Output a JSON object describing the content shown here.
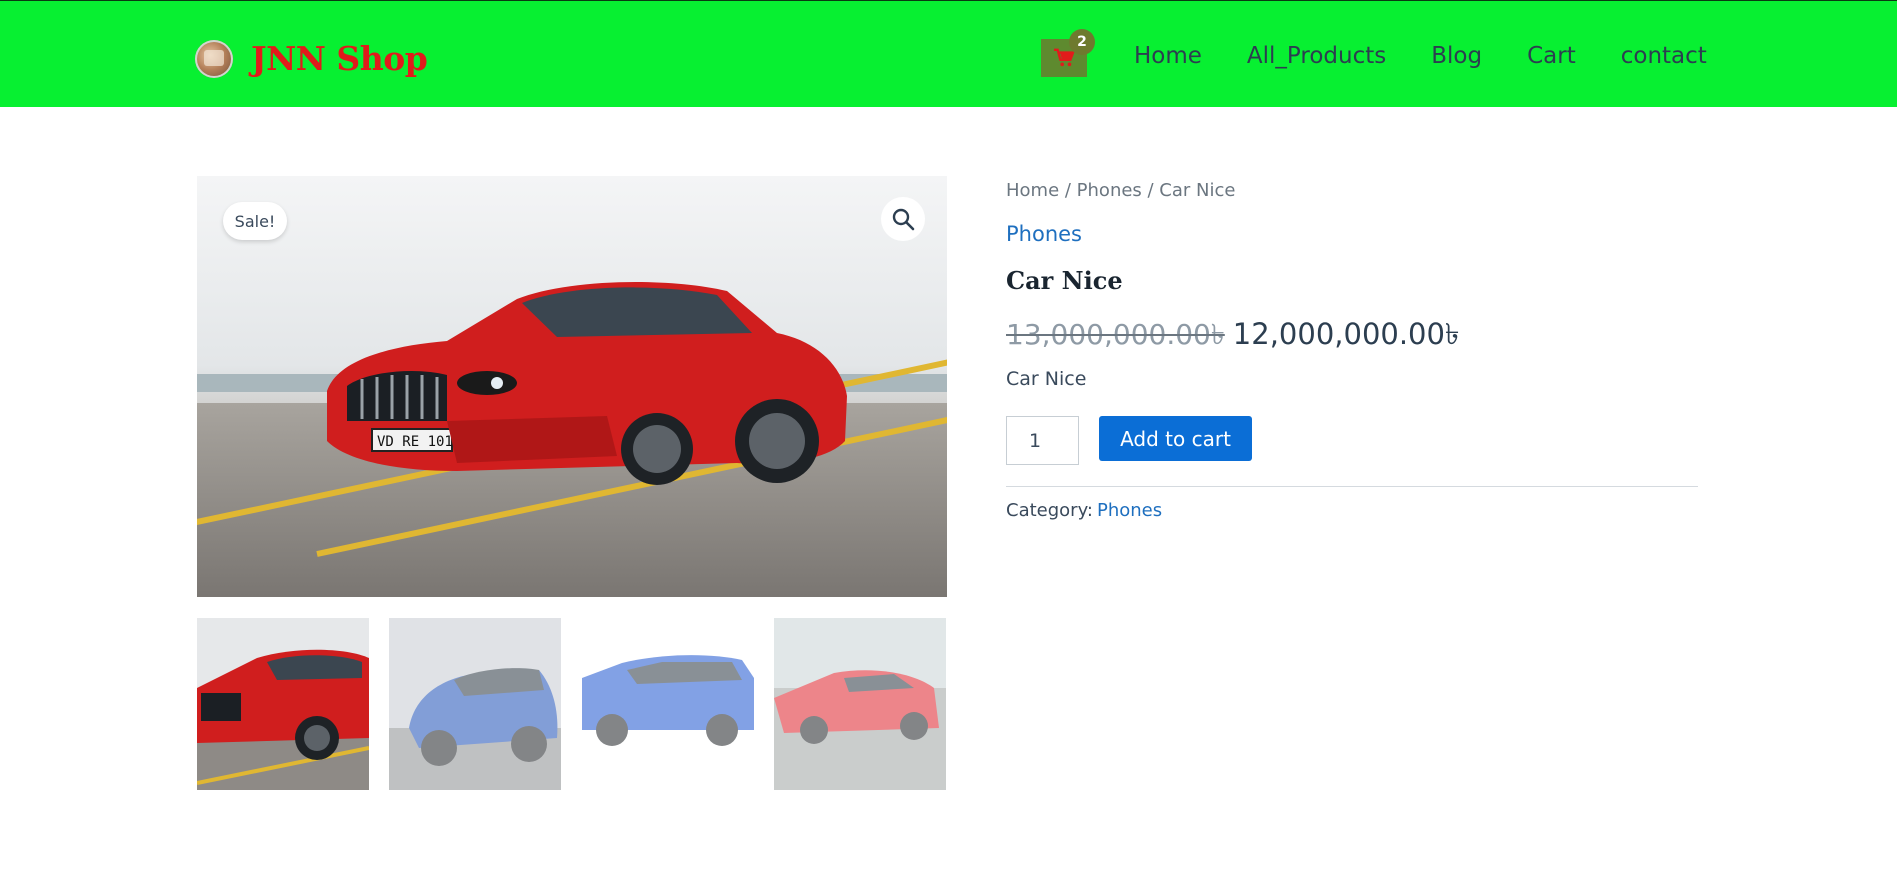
{
  "header": {
    "brand_name": "JNN Shop",
    "cart_count": "2",
    "nav": [
      "Home",
      "All_Products",
      "Blog",
      "Cart",
      "contact"
    ]
  },
  "gallery": {
    "sale_label": "Sale!",
    "thumbnails": [
      "red-sedan",
      "blue-hatchback-front",
      "blue-hatchback-side",
      "red-sports-car"
    ]
  },
  "product": {
    "breadcrumb": "Home / Phones / Car Nice",
    "category_link": "Phones",
    "title": "Car Nice",
    "price_old": "13,000,000.00৳",
    "price_new": "12,000,000.00৳",
    "short_description": "Car Nice",
    "quantity": "1",
    "add_to_cart_label": "Add to cart",
    "meta_label": "Category:",
    "meta_category": "Phones"
  },
  "colors": {
    "header_bg": "#07f031",
    "brand_red": "#e11b1b",
    "link_blue": "#1e6fbf",
    "button_blue": "#0b6ed6"
  }
}
